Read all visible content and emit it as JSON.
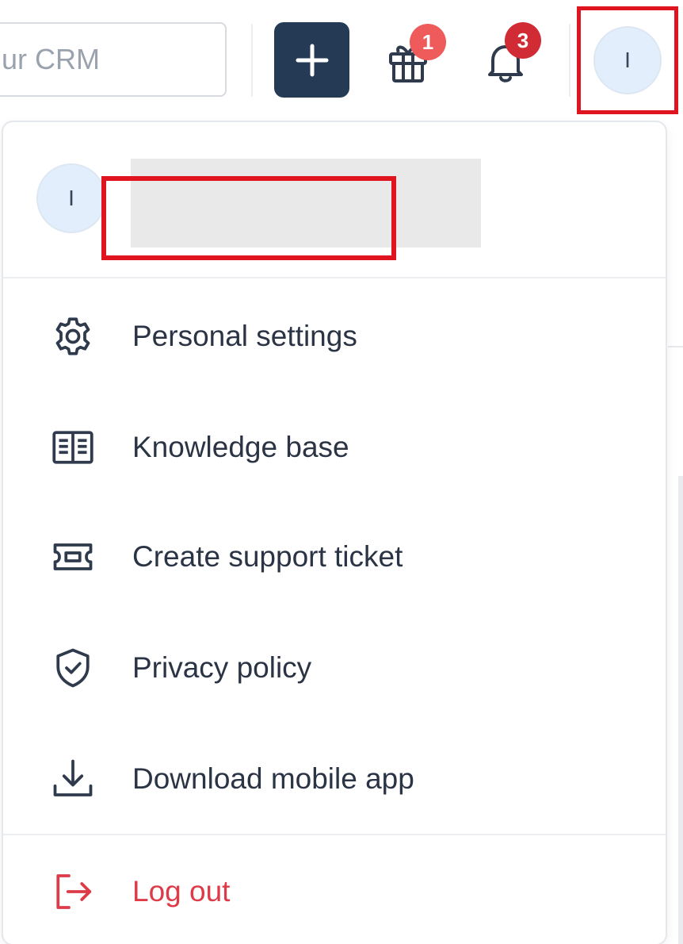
{
  "header": {
    "search": {
      "placeholder": "ur CRM"
    },
    "add_button": {
      "icon": "plus-icon"
    },
    "gift": {
      "icon": "gift-icon",
      "badge": "1",
      "badge_color": "#ef5a5a"
    },
    "notifications": {
      "icon": "bell-icon",
      "badge": "3",
      "badge_color": "#d12c35"
    },
    "avatar": {
      "initial": "I"
    }
  },
  "profile": {
    "initial": "I"
  },
  "menu": {
    "items": [
      {
        "label": "Personal settings",
        "icon": "gear-icon"
      },
      {
        "label": "Knowledge base",
        "icon": "book-icon"
      },
      {
        "label": "Create support ticket",
        "icon": "ticket-icon"
      },
      {
        "label": "Privacy policy",
        "icon": "shield-check-icon"
      },
      {
        "label": "Download mobile app",
        "icon": "download-icon"
      }
    ],
    "logout": {
      "label": "Log out",
      "icon": "logout-icon",
      "color": "#dd3b47"
    }
  },
  "colors": {
    "primary_button": "#243a55",
    "highlight": "#e0141e",
    "avatar_bg": "#e2eefc"
  }
}
